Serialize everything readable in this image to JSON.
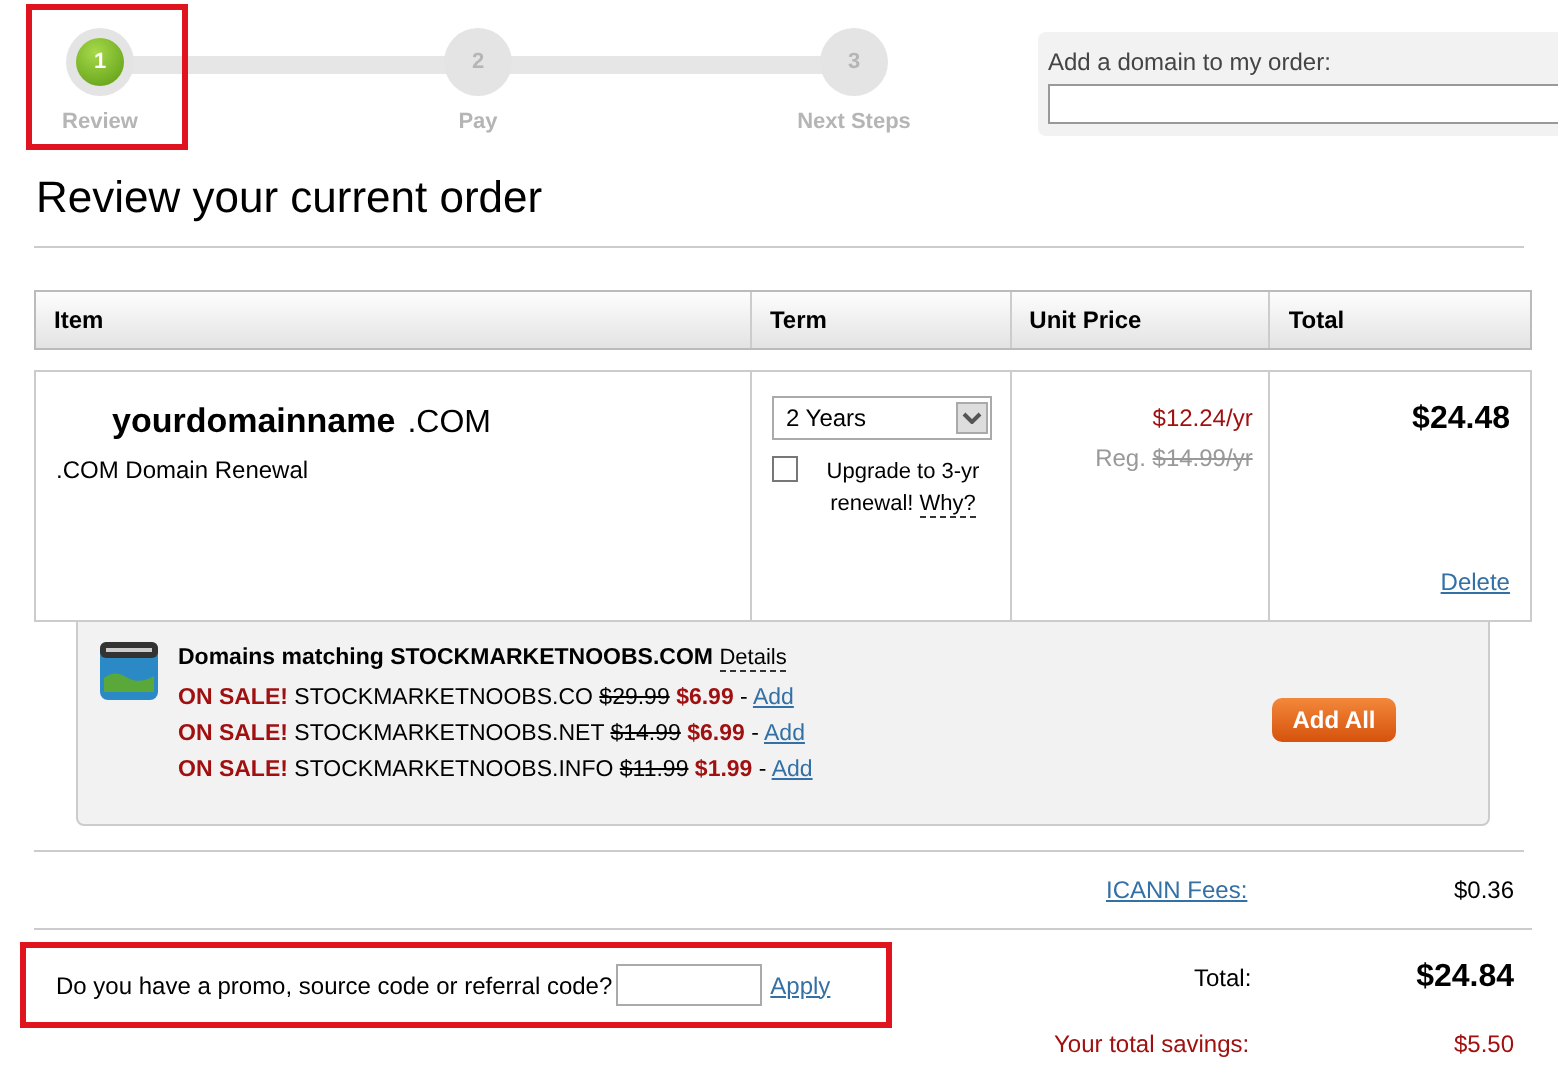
{
  "steps": [
    {
      "number": "1",
      "label": "Review",
      "selected": true
    },
    {
      "number": "2",
      "label": "Pay",
      "selected": false
    },
    {
      "number": "3",
      "label": "Next Steps",
      "selected": false
    }
  ],
  "add_domain": {
    "label": "Add a domain to my order:"
  },
  "heading": "Review your current order",
  "table": {
    "columns": [
      "Item",
      "Term",
      "Unit Price",
      "Total"
    ],
    "rows": [
      {
        "domain": "yourdomainname",
        "tld": ".COM",
        "description": ".COM Domain Renewal",
        "term": "2 Years",
        "upgrade": {
          "checked": false,
          "label": "Upgrade to 3-yr renewal!",
          "link": "Why?"
        },
        "unit_price": "$12.24/yr",
        "reg_label": "Reg.",
        "regular_price": "$14.99/yr",
        "total": "$24.48",
        "delete": "Delete"
      }
    ]
  },
  "suggestions": {
    "title": "Domains matching STOCKMARKETNOOBS.COM",
    "details": "Details",
    "button": "Add All",
    "items": [
      {
        "badge": "ON SALE!",
        "domain": "STOCKMARKETNOOBS.CO",
        "old_price": "$29.99",
        "price": "$6.99",
        "separator": "-",
        "link": "Add"
      },
      {
        "badge": "ON SALE!",
        "domain": "STOCKMARKETNOOBS.NET",
        "old_price": "$14.99",
        "price": "$6.99",
        "separator": "-",
        "link": "Add"
      },
      {
        "badge": "ON SALE!",
        "domain": "STOCKMARKETNOOBS.INFO",
        "old_price": "$11.99",
        "price": "$1.99",
        "separator": "-",
        "link": "Add"
      }
    ]
  },
  "fees": {
    "label": "ICANN Fees:",
    "value": "$0.36"
  },
  "promo": {
    "label": "Do you have a promo, source code or referral code?",
    "apply": "Apply"
  },
  "total": {
    "label": "Total:",
    "value": "$24.84"
  },
  "savings": {
    "label": "Your total savings:",
    "value": "$5.50"
  }
}
